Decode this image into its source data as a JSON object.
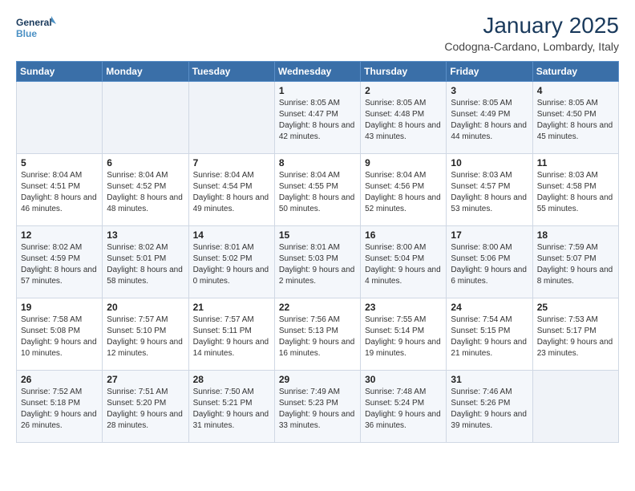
{
  "header": {
    "logo_line1": "General",
    "logo_line2": "Blue",
    "title": "January 2025",
    "subtitle": "Codogna-Cardano, Lombardy, Italy"
  },
  "days_of_week": [
    "Sunday",
    "Monday",
    "Tuesday",
    "Wednesday",
    "Thursday",
    "Friday",
    "Saturday"
  ],
  "weeks": [
    [
      {
        "day": "",
        "info": ""
      },
      {
        "day": "",
        "info": ""
      },
      {
        "day": "",
        "info": ""
      },
      {
        "day": "1",
        "info": "Sunrise: 8:05 AM\nSunset: 4:47 PM\nDaylight: 8 hours and 42 minutes."
      },
      {
        "day": "2",
        "info": "Sunrise: 8:05 AM\nSunset: 4:48 PM\nDaylight: 8 hours and 43 minutes."
      },
      {
        "day": "3",
        "info": "Sunrise: 8:05 AM\nSunset: 4:49 PM\nDaylight: 8 hours and 44 minutes."
      },
      {
        "day": "4",
        "info": "Sunrise: 8:05 AM\nSunset: 4:50 PM\nDaylight: 8 hours and 45 minutes."
      }
    ],
    [
      {
        "day": "5",
        "info": "Sunrise: 8:04 AM\nSunset: 4:51 PM\nDaylight: 8 hours and 46 minutes."
      },
      {
        "day": "6",
        "info": "Sunrise: 8:04 AM\nSunset: 4:52 PM\nDaylight: 8 hours and 48 minutes."
      },
      {
        "day": "7",
        "info": "Sunrise: 8:04 AM\nSunset: 4:54 PM\nDaylight: 8 hours and 49 minutes."
      },
      {
        "day": "8",
        "info": "Sunrise: 8:04 AM\nSunset: 4:55 PM\nDaylight: 8 hours and 50 minutes."
      },
      {
        "day": "9",
        "info": "Sunrise: 8:04 AM\nSunset: 4:56 PM\nDaylight: 8 hours and 52 minutes."
      },
      {
        "day": "10",
        "info": "Sunrise: 8:03 AM\nSunset: 4:57 PM\nDaylight: 8 hours and 53 minutes."
      },
      {
        "day": "11",
        "info": "Sunrise: 8:03 AM\nSunset: 4:58 PM\nDaylight: 8 hours and 55 minutes."
      }
    ],
    [
      {
        "day": "12",
        "info": "Sunrise: 8:02 AM\nSunset: 4:59 PM\nDaylight: 8 hours and 57 minutes."
      },
      {
        "day": "13",
        "info": "Sunrise: 8:02 AM\nSunset: 5:01 PM\nDaylight: 8 hours and 58 minutes."
      },
      {
        "day": "14",
        "info": "Sunrise: 8:01 AM\nSunset: 5:02 PM\nDaylight: 9 hours and 0 minutes."
      },
      {
        "day": "15",
        "info": "Sunrise: 8:01 AM\nSunset: 5:03 PM\nDaylight: 9 hours and 2 minutes."
      },
      {
        "day": "16",
        "info": "Sunrise: 8:00 AM\nSunset: 5:04 PM\nDaylight: 9 hours and 4 minutes."
      },
      {
        "day": "17",
        "info": "Sunrise: 8:00 AM\nSunset: 5:06 PM\nDaylight: 9 hours and 6 minutes."
      },
      {
        "day": "18",
        "info": "Sunrise: 7:59 AM\nSunset: 5:07 PM\nDaylight: 9 hours and 8 minutes."
      }
    ],
    [
      {
        "day": "19",
        "info": "Sunrise: 7:58 AM\nSunset: 5:08 PM\nDaylight: 9 hours and 10 minutes."
      },
      {
        "day": "20",
        "info": "Sunrise: 7:57 AM\nSunset: 5:10 PM\nDaylight: 9 hours and 12 minutes."
      },
      {
        "day": "21",
        "info": "Sunrise: 7:57 AM\nSunset: 5:11 PM\nDaylight: 9 hours and 14 minutes."
      },
      {
        "day": "22",
        "info": "Sunrise: 7:56 AM\nSunset: 5:13 PM\nDaylight: 9 hours and 16 minutes."
      },
      {
        "day": "23",
        "info": "Sunrise: 7:55 AM\nSunset: 5:14 PM\nDaylight: 9 hours and 19 minutes."
      },
      {
        "day": "24",
        "info": "Sunrise: 7:54 AM\nSunset: 5:15 PM\nDaylight: 9 hours and 21 minutes."
      },
      {
        "day": "25",
        "info": "Sunrise: 7:53 AM\nSunset: 5:17 PM\nDaylight: 9 hours and 23 minutes."
      }
    ],
    [
      {
        "day": "26",
        "info": "Sunrise: 7:52 AM\nSunset: 5:18 PM\nDaylight: 9 hours and 26 minutes."
      },
      {
        "day": "27",
        "info": "Sunrise: 7:51 AM\nSunset: 5:20 PM\nDaylight: 9 hours and 28 minutes."
      },
      {
        "day": "28",
        "info": "Sunrise: 7:50 AM\nSunset: 5:21 PM\nDaylight: 9 hours and 31 minutes."
      },
      {
        "day": "29",
        "info": "Sunrise: 7:49 AM\nSunset: 5:23 PM\nDaylight: 9 hours and 33 minutes."
      },
      {
        "day": "30",
        "info": "Sunrise: 7:48 AM\nSunset: 5:24 PM\nDaylight: 9 hours and 36 minutes."
      },
      {
        "day": "31",
        "info": "Sunrise: 7:46 AM\nSunset: 5:26 PM\nDaylight: 9 hours and 39 minutes."
      },
      {
        "day": "",
        "info": ""
      }
    ]
  ]
}
